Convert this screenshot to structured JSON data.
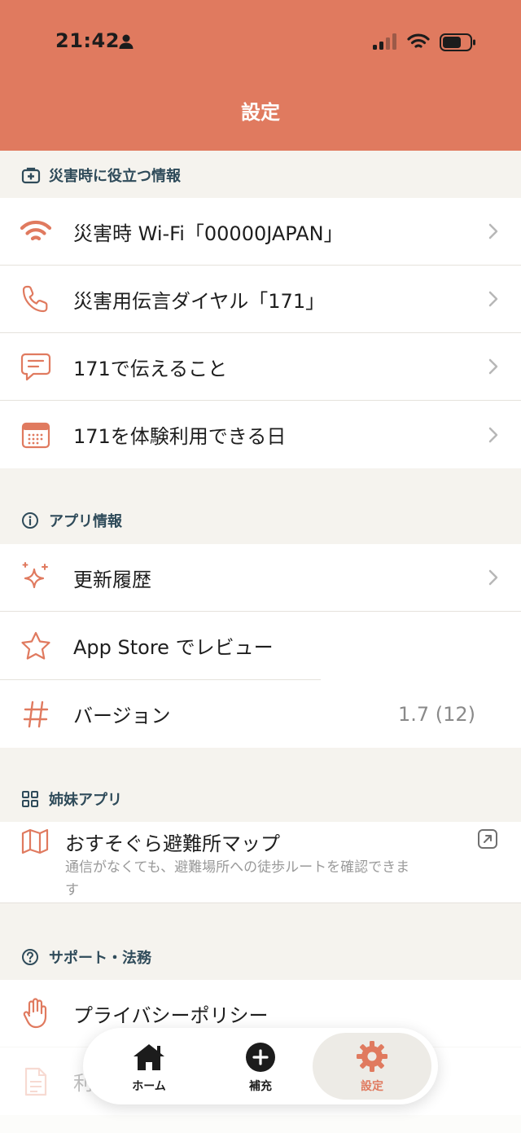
{
  "status_bar": {
    "time": "21:42"
  },
  "nav": {
    "title": "設定"
  },
  "sections": {
    "disaster": {
      "label": "災害時に役立つ情報",
      "items": [
        {
          "label": "災害時 Wi-Fi「00000JAPAN」"
        },
        {
          "label": "災害用伝言ダイヤル「171」"
        },
        {
          "label": "171で伝えること"
        },
        {
          "label": "171を体験利用できる日"
        }
      ]
    },
    "app_info": {
      "label": "アプリ情報",
      "items": [
        {
          "label": "更新履歴"
        },
        {
          "label": "App Store でレビュー"
        },
        {
          "label": "バージョン",
          "value": "1.7 (12)"
        }
      ]
    },
    "sister_apps": {
      "label": "姉妹アプリ",
      "app": {
        "title": "おすそぐら避難所マップ",
        "description": "通信がなくても、避難場所への徒歩ルートを確認できます"
      }
    },
    "support": {
      "label": "サポート・法務",
      "items": [
        {
          "label": "プライバシーポリシー"
        },
        {
          "label": "利"
        }
      ]
    }
  },
  "tab_bar": {
    "home": "ホーム",
    "add": "補充",
    "settings": "設定",
    "active": "settings"
  },
  "colors": {
    "accent": "#e07a5f",
    "section_text": "#2f4b5a",
    "background": "#f5f3ee"
  }
}
